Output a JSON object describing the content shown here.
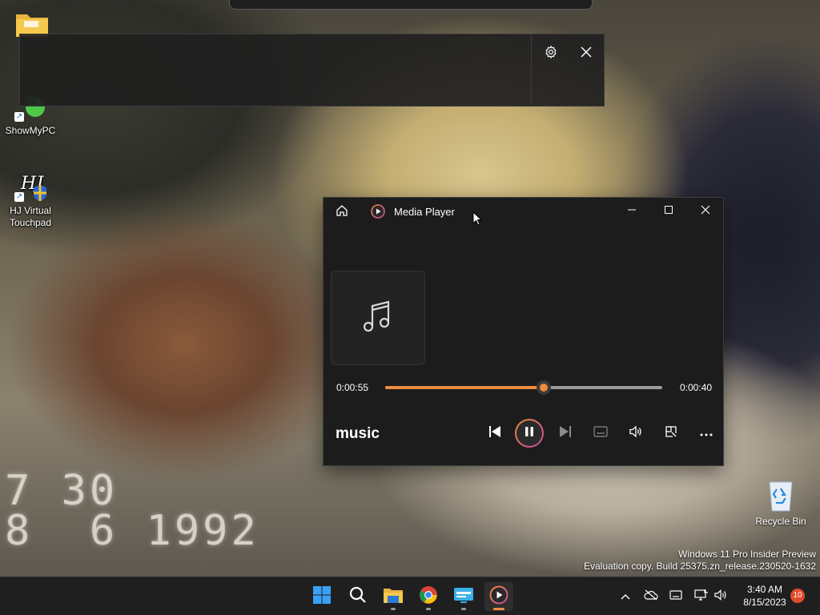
{
  "desktop": {
    "icons": [
      {
        "label": "",
        "icon": "folder-icon"
      },
      {
        "label": "ShowMyPC",
        "icon": "showmypc-icon"
      },
      {
        "label": "HJ Virtual Touchpad",
        "icon": "touchpad-icon"
      },
      {
        "label": "Recycle Bin",
        "icon": "recycle-bin-icon"
      }
    ],
    "wallpaper_date": [
      "7 30",
      "8  6 1992"
    ],
    "watermark": {
      "line1": "Windows 11 Pro Insider Preview",
      "line2": "Evaluation copy. Build 25375.zn_release.230520-1632"
    }
  },
  "overlay": {
    "icons": [
      "gear-icon",
      "close-icon"
    ]
  },
  "media_player": {
    "title": "Media Player",
    "elapsed": "0:00:55",
    "remaining": "0:00:40",
    "progress_fraction": 0.571,
    "song": "music",
    "accent": "#f08a3c",
    "controls": [
      "previous-icon",
      "pause-icon",
      "next-icon",
      "captions-icon",
      "volume-icon",
      "mini-player-icon",
      "more-icon"
    ]
  },
  "taskbar": {
    "apps": [
      "start-icon",
      "search-icon",
      "file-explorer-icon",
      "chrome-icon",
      "remote-desktop-icon",
      "media-player-icon"
    ],
    "tray": [
      "chevron-up-icon",
      "cloud-icon",
      "keyboard-icon",
      "network-icon",
      "volume-icon"
    ],
    "time": "3:40 AM",
    "date": "8/15/2023",
    "notification_count": "10"
  }
}
